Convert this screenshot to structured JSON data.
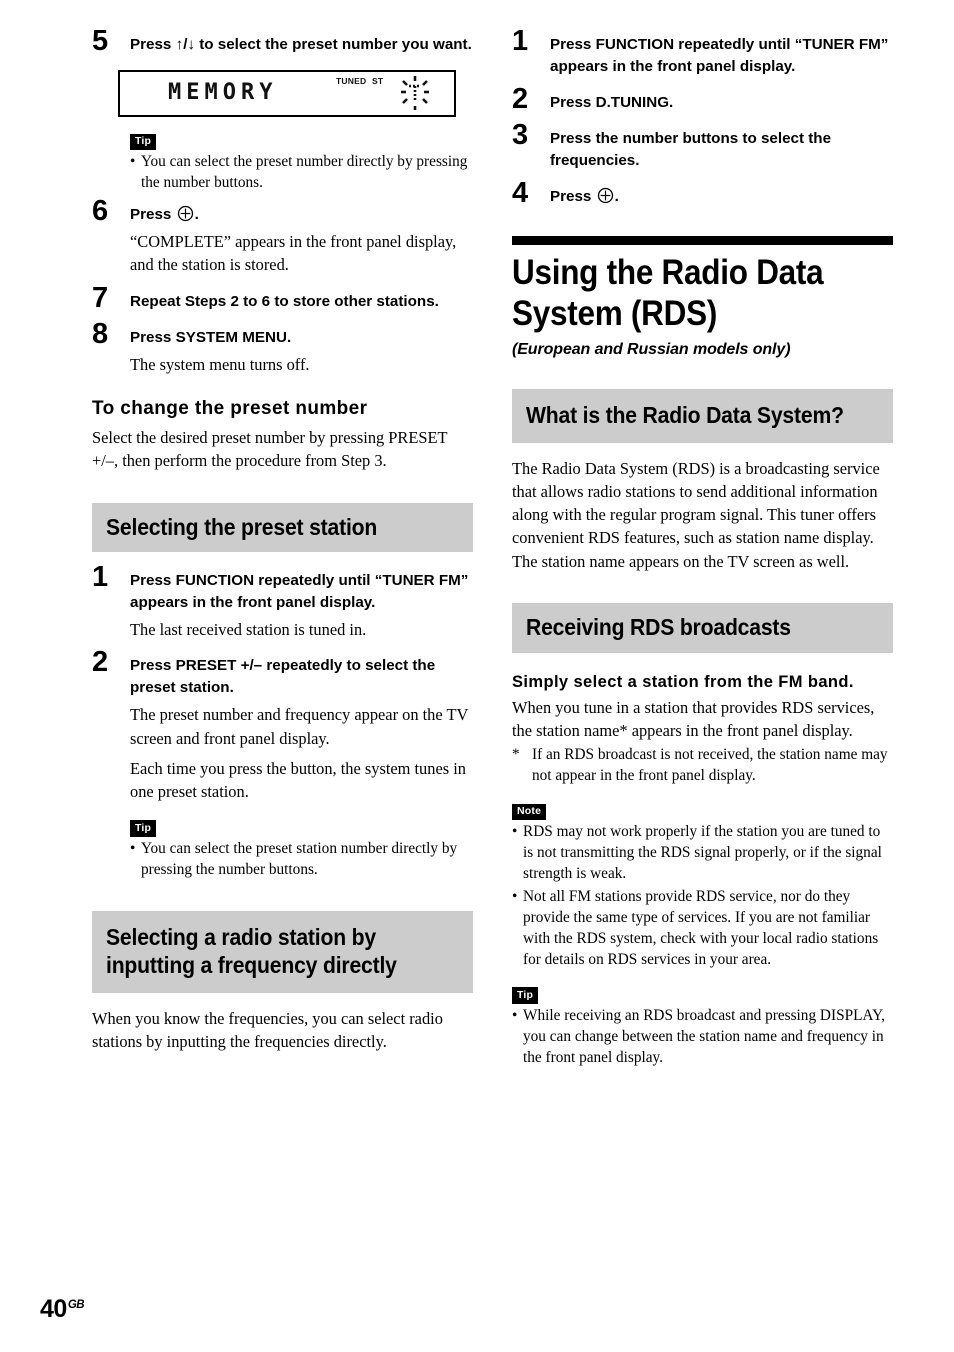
{
  "page": {
    "number": "40",
    "region_code": "GB"
  },
  "left_column": {
    "step5": {
      "num": "5",
      "title": "Press ↑/↓ to select the preset number you want."
    },
    "display_figure": {
      "text": "MEMORY",
      "tuned_label": "TUNED",
      "st_label": "ST",
      "blink_icon": "blinking-preset-digit-icon"
    },
    "tip1": {
      "badge": "Tip",
      "items": [
        "You can select the preset number directly by pressing the number buttons."
      ]
    },
    "step6": {
      "num": "6",
      "title_before": "Press",
      "title_after": ".",
      "enter_icon": "enter-button-icon",
      "body": "“COMPLETE” appears in the front panel display, and the station is stored."
    },
    "step7": {
      "num": "7",
      "title": "Repeat Steps 2 to 6 to store other stations."
    },
    "step8": {
      "num": "8",
      "title": "Press SYSTEM MENU.",
      "body": "The system menu turns off."
    },
    "subhead1": "To change the preset number",
    "para1": "Select the desired preset number by pressing PRESET +/–, then perform the procedure from Step 3.",
    "banner1": "Selecting the preset station",
    "step1": {
      "num": "1",
      "title": "Press FUNCTION repeatedly until “TUNER FM” appears in the front panel display.",
      "body": "The last received station is tuned in."
    },
    "step2": {
      "num": "2",
      "title": "Press PRESET +/– repeatedly to select the preset station.",
      "body1": "The preset number and frequency appear on the TV screen and front panel display.",
      "body2": "Each time you press the button, the system tunes in one preset station."
    },
    "tip2": {
      "badge": "Tip",
      "items": [
        "You can select the preset station number directly by pressing the number buttons."
      ]
    },
    "banner2": "Selecting a radio station by inputting a frequency directly",
    "para2": "When you know the frequencies, you can select radio stations by inputting the frequencies directly."
  },
  "right_column": {
    "step1": {
      "num": "1",
      "title": "Press FUNCTION repeatedly until “TUNER FM” appears in the front panel display."
    },
    "step2": {
      "num": "2",
      "title": "Press D.TUNING."
    },
    "step3": {
      "num": "3",
      "title": "Press the number buttons to select the frequencies."
    },
    "step4": {
      "num": "4",
      "title_before": "Press",
      "title_after": ".",
      "enter_icon": "enter-button-icon"
    },
    "chapter": {
      "title": "Using the Radio Data System (RDS)",
      "subtitle": "(European and Russian models only)"
    },
    "banner1": "What is the Radio Data System?",
    "para1": "The Radio Data System (RDS) is a broadcasting service that allows radio stations to send additional information along with the regular program signal. This tuner offers convenient RDS features, such as station name display. The station name appears on the TV screen as well.",
    "banner2": "Receiving RDS broadcasts",
    "subhead1": "Simply select a station from the FM band.",
    "para2": "When you tune in a station that provides RDS services, the station name* appears in the front panel display.",
    "footnote": {
      "marker": "*",
      "text": "If an RDS broadcast is not received, the station name may not appear in the front panel display."
    },
    "note1": {
      "badge": "Note",
      "items": [
        "RDS may not work properly if the station you are tuned to is not transmitting the RDS signal properly, or if the signal strength is weak.",
        "Not all FM stations provide RDS service, nor do they provide the same type of services. If you are not familiar with the RDS system, check with your local radio stations for details on RDS services in your area."
      ]
    },
    "tip1": {
      "badge": "Tip",
      "items": [
        "While receiving an RDS broadcast and pressing DISPLAY, you can change between the station name and frequency in the front panel display."
      ]
    }
  },
  "colors": {
    "banner_gray": "#cccccc",
    "ink": "#000000",
    "paper": "#ffffff"
  }
}
